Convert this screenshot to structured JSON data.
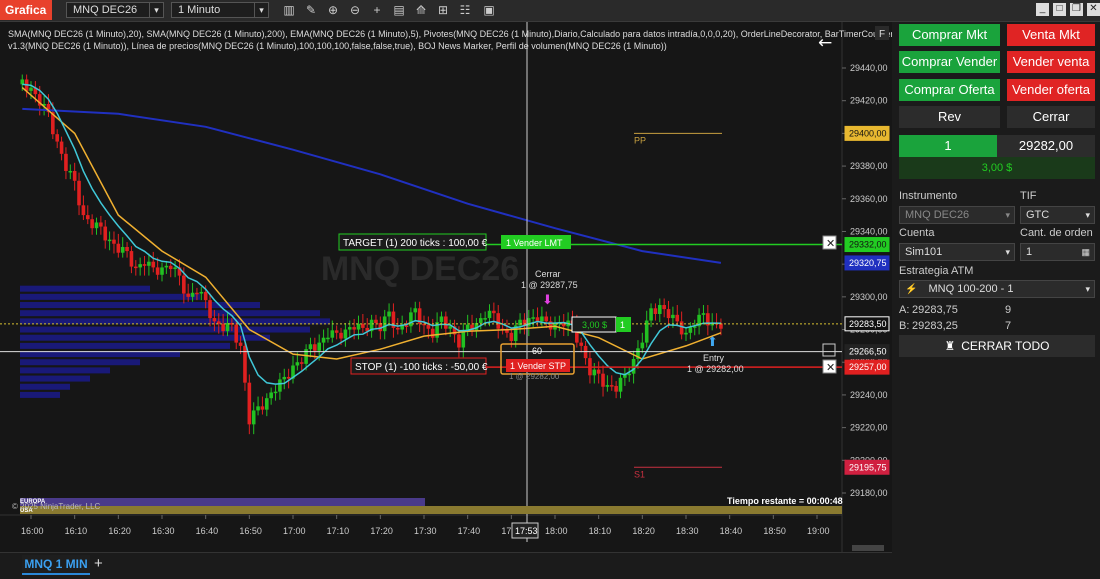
{
  "window": {
    "title": "Grafica"
  },
  "toolbar": {
    "instrument": "MNQ DEC26",
    "interval": "1 Minuto",
    "icons": [
      "bar-type-icon",
      "pencil-icon",
      "zoom-in-icon",
      "zoom-out-icon",
      "crosshair-icon",
      "data-box-icon",
      "indicators-icon",
      "strategies-icon",
      "properties-icon",
      "chart-trader-icon"
    ]
  },
  "window_controls": [
    "minimize-icon",
    "maximize-icon",
    "restore-icon",
    "close-icon"
  ],
  "chart": {
    "indicators_line1": "SMA(MNQ DEC26 (1 Minuto),20), SMA(MNQ DEC26 (1 Minuto),200), EMA(MNQ DEC26 (1 Minuto),5), Pivotes(MNQ DEC26 (1 Minuto),Diario,Calculado para datos intradía,0,0,0,20), OrderLineDecorator, BarTimerCounter",
    "indicators_line2": "v1.3(MNQ DEC26 (1 Minuto)), Línea de precios(MNQ DEC26 (1 Minuto),100,100,100,false,false,true), BOJ News Marker, Perfil de volumen(MNQ DEC26 (1 Minuto))",
    "watermark": "MNQ DEC26",
    "f_button": "F",
    "copyright": "© 2025 NinjaTrader, LLC",
    "timer": "Tiempo restante = 00:00:48",
    "sessions": [
      "EUROPA",
      "USA"
    ],
    "y_ticks": [
      "29440,00",
      "29420,00",
      "29400,00",
      "29380,00",
      "29360,00",
      "29340,00",
      "29320,00",
      "29300,00",
      "29280,00",
      "29260,00",
      "29240,00",
      "29220,00",
      "29200,00",
      "29180,00"
    ],
    "x_ticks": [
      "16:00",
      "16:10",
      "16:20",
      "16:30",
      "16:40",
      "16:50",
      "17:00",
      "17:10",
      "17:20",
      "17:30",
      "17:40",
      "17:50",
      "18:00",
      "18:10",
      "18:20",
      "18:30",
      "18:40",
      "18:50",
      "19:00"
    ],
    "crosshair_time": "17:53",
    "price_labels": {
      "pp": "29400,00",
      "target": "29332,00",
      "sma200": "29320,75",
      "last": "29283,50",
      "line": "29266,50",
      "stop": "29257,00",
      "s1": "29195,75"
    },
    "pivot_pp": "PP",
    "pivot_s1": "S1",
    "target_label": "TARGET (1) 200 ticks : 100,00 €",
    "target_order": "1  Vender LMT",
    "stop_label": "STOP (1) -100 ticks : -50,00 €",
    "stop_order": "1  Vender STP",
    "pnl_box": "3,00 $",
    "pnl_qty": "1",
    "cerrar_label": "Cerrar",
    "cerrar_fill": "1 @ 29287,75",
    "entry_label": "Entry",
    "entry_fill": "1 @ 29282,00",
    "bar_count": "60",
    "stop_fill_ghost": "1 @ 29282,00"
  },
  "chart_data": {
    "type": "candlestick",
    "instrument": "MNQ DEC26",
    "interval": "1 Minuto",
    "x_range": [
      "16:00",
      "19:00"
    ],
    "y_range": [
      29170,
      29450
    ],
    "close_path": [
      [
        "15:58",
        29430
      ],
      [
        "16:00",
        29428
      ],
      [
        "16:02",
        29420
      ],
      [
        "16:04",
        29410
      ],
      [
        "16:06",
        29395
      ],
      [
        "16:08",
        29380
      ],
      [
        "16:10",
        29368
      ],
      [
        "16:12",
        29350
      ],
      [
        "16:14",
        29345
      ],
      [
        "16:16",
        29340
      ],
      [
        "16:18",
        29335
      ],
      [
        "16:20",
        29330
      ],
      [
        "16:22",
        29325
      ],
      [
        "16:24",
        29318
      ],
      [
        "16:26",
        29322
      ],
      [
        "16:28",
        29315
      ],
      [
        "16:30",
        29318
      ],
      [
        "16:32",
        29320
      ],
      [
        "16:34",
        29310
      ],
      [
        "16:36",
        29300
      ],
      [
        "16:38",
        29305
      ],
      [
        "16:40",
        29295
      ],
      [
        "16:42",
        29285
      ],
      [
        "16:44",
        29282
      ],
      [
        "16:46",
        29280
      ],
      [
        "16:48",
        29270
      ],
      [
        "16:50",
        29225
      ],
      [
        "16:52",
        29230
      ],
      [
        "16:54",
        29238
      ],
      [
        "16:56",
        29245
      ],
      [
        "16:58",
        29248
      ],
      [
        "17:00",
        29258
      ],
      [
        "17:02",
        29262
      ],
      [
        "17:04",
        29268
      ],
      [
        "17:06",
        29272
      ],
      [
        "17:08",
        29278
      ],
      [
        "17:10",
        29275
      ],
      [
        "17:12",
        29280
      ],
      [
        "17:14",
        29283
      ],
      [
        "17:16",
        29278
      ],
      [
        "17:18",
        29286
      ],
      [
        "17:20",
        29282
      ],
      [
        "17:22",
        29288
      ],
      [
        "17:24",
        29280
      ],
      [
        "17:26",
        29285
      ],
      [
        "17:28",
        29290
      ],
      [
        "17:30",
        29283
      ],
      [
        "17:32",
        29278
      ],
      [
        "17:34",
        29285
      ],
      [
        "17:36",
        29282
      ],
      [
        "17:38",
        29272
      ],
      [
        "17:40",
        29280
      ],
      [
        "17:42",
        29284
      ],
      [
        "17:44",
        29290
      ],
      [
        "17:46",
        29287
      ],
      [
        "17:48",
        29280
      ],
      [
        "17:50",
        29276
      ],
      [
        "17:52",
        29283
      ],
      [
        "17:54",
        29287
      ],
      [
        "17:56",
        29288
      ],
      [
        "17:58",
        29282
      ],
      [
        "18:00",
        29284
      ],
      [
        "18:02",
        29285
      ],
      [
        "18:04",
        29280
      ],
      [
        "18:06",
        29270
      ],
      [
        "18:08",
        29255
      ],
      [
        "18:10",
        29250
      ],
      [
        "18:12",
        29246
      ],
      [
        "18:14",
        29245
      ],
      [
        "18:16",
        29250
      ],
      [
        "18:18",
        29262
      ],
      [
        "18:20",
        29275
      ],
      [
        "18:22",
        29290
      ],
      [
        "18:24",
        29295
      ],
      [
        "18:26",
        29290
      ],
      [
        "18:28",
        29282
      ],
      [
        "18:30",
        29278
      ],
      [
        "18:32",
        29285
      ],
      [
        "18:34",
        29287
      ],
      [
        "18:36",
        29284
      ],
      [
        "18:38",
        29283.5
      ]
    ],
    "sma20_path": [
      [
        "15:58",
        29428
      ],
      [
        "16:10",
        29400
      ],
      [
        "16:20",
        29350
      ],
      [
        "16:30",
        29328
      ],
      [
        "16:40",
        29312
      ],
      [
        "16:50",
        29280
      ],
      [
        "17:00",
        29265
      ],
      [
        "17:10",
        29262
      ],
      [
        "17:20",
        29268
      ],
      [
        "17:30",
        29276
      ],
      [
        "17:40",
        29279
      ],
      [
        "17:50",
        29280
      ],
      [
        "18:00",
        29282
      ],
      [
        "18:10",
        29275
      ],
      [
        "18:20",
        29262
      ],
      [
        "18:30",
        29270
      ],
      [
        "18:38",
        29278
      ]
    ],
    "sma200_path": [
      [
        "15:58",
        29415
      ],
      [
        "16:20",
        29412
      ],
      [
        "16:40",
        29404
      ],
      [
        "17:00",
        29390
      ],
      [
        "17:20",
        29375
      ],
      [
        "17:40",
        29357
      ],
      [
        "18:00",
        29342
      ],
      [
        "18:20",
        29328
      ],
      [
        "18:38",
        29320.75
      ]
    ],
    "pivots": {
      "PP": 29400.0,
      "S1": 29195.75
    },
    "orders": {
      "target": 29332.0,
      "stop": 29257.0,
      "entry": 29282.0
    },
    "last_price": 29283.5
  },
  "trader": {
    "buy_mkt": "Comprar Mkt",
    "sell_mkt": "Venta Mkt",
    "buy_bid": "Comprar Vender",
    "sell_ask": "Vender venta",
    "buy_offer": "Comprar Oferta",
    "sell_offer": "Vender oferta",
    "rev": "Rev",
    "close": "Cerrar",
    "position_qty": "1",
    "position_price": "29282,00",
    "pnl": "3,00 $",
    "instrument_label": "Instrumento",
    "instrument_value": "MNQ DEC26",
    "tif_label": "TIF",
    "tif_value": "GTC",
    "account_label": "Cuenta",
    "account_value": "Sim101",
    "qty_label": "Cant. de orden",
    "qty_value": "1",
    "atm_label": "Estrategia ATM",
    "atm_value": "MNQ 100-200 - 1",
    "ask_label": "A:",
    "ask_price": "29283,75",
    "ask_size": "9",
    "bid_label": "B:",
    "bid_price": "29283,25",
    "bid_size": "7",
    "close_all": "CERRAR TODO"
  },
  "bottom": {
    "tab_label": "MNQ 1 MIN",
    "add": "+"
  },
  "colors": {
    "accent": "#e8412c",
    "buy": "#1aa33c",
    "sell": "#e02424",
    "sma20": "#f0b030",
    "sma200": "#2030c0",
    "ema5": "#40c8d8",
    "target": "#22cc22",
    "stop": "#e02020"
  }
}
